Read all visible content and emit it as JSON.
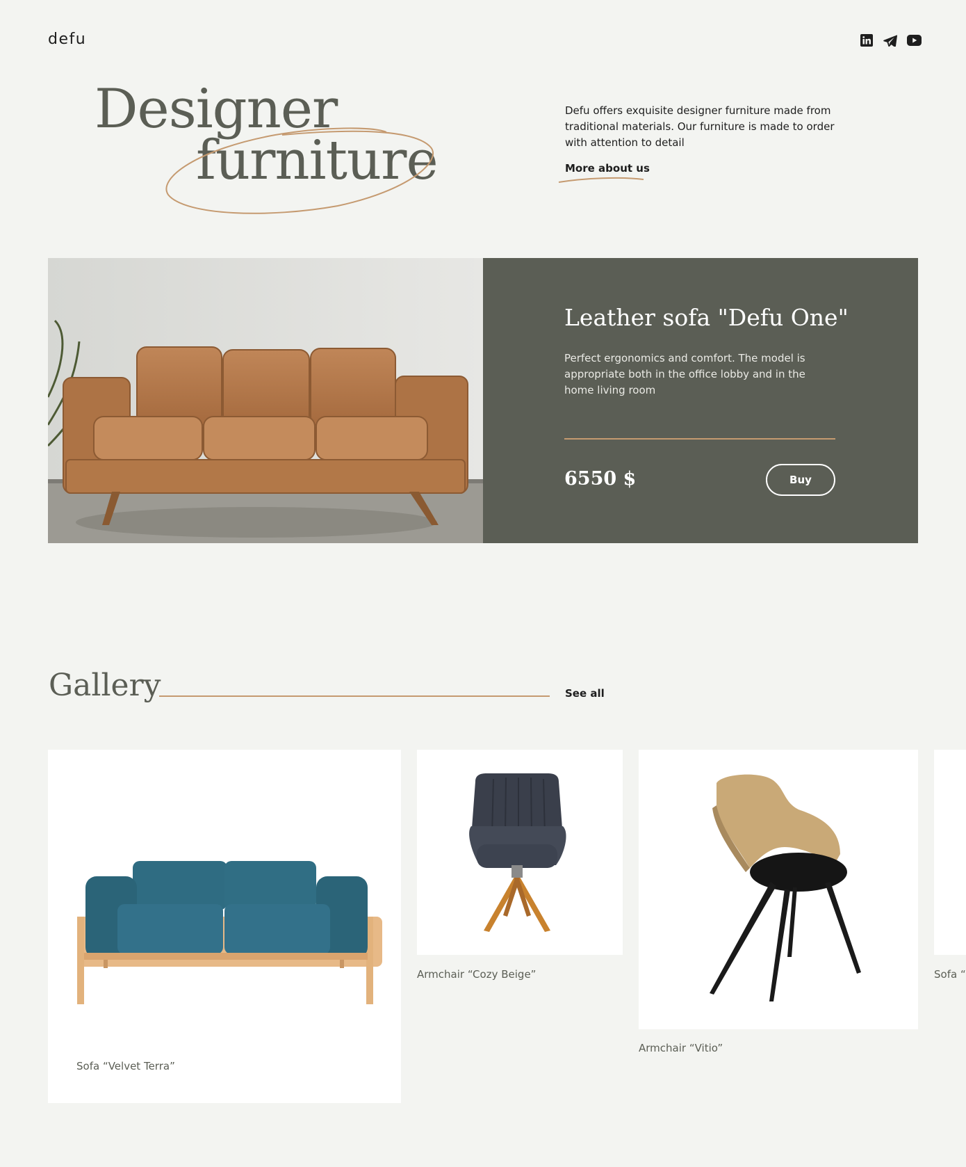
{
  "header": {
    "logo": "defu",
    "socials": [
      {
        "icon": "linkedin-icon"
      },
      {
        "icon": "telegram-icon"
      },
      {
        "icon": "youtube-icon"
      }
    ]
  },
  "hero": {
    "title_line1": "Designer",
    "title_line2": "furniture",
    "intro": "Defu offers exquisite designer furniture made from traditional materials. Our furniture is made to order with attention to detail",
    "more_link": "More about us"
  },
  "featured": {
    "title": "Leather sofa \"Defu One\"",
    "description": "Perfect ergonomics and comfort. The model is appropriate both in the office lobby and in the home living room",
    "price": "6550 $",
    "buy_label": "Buy"
  },
  "gallery": {
    "title": "Gallery",
    "see_all": "See all",
    "items": [
      {
        "label": "Sofa “Velvet Terra”"
      },
      {
        "label": "Armchair “Cozy Beige”"
      },
      {
        "label": "Armchair “Vitio”"
      },
      {
        "label": "Sofa “L"
      }
    ]
  },
  "colors": {
    "background": "#f3f4f1",
    "olive": "#5b5e55",
    "accent": "#c59a70",
    "text": "#1e1e1e"
  }
}
